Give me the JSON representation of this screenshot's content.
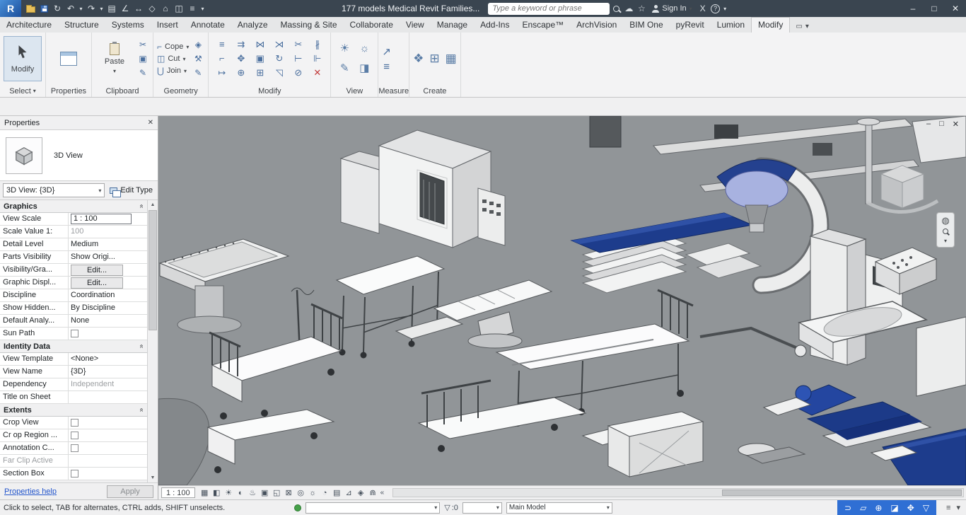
{
  "theme": {
    "titlebar_bg": "#3a4550",
    "viewport_bg": "#919598",
    "equipment_blue": "#1d3c8c",
    "status_blue": "#2f6fd4"
  },
  "titlebar": {
    "logo_text": "R",
    "qat": [
      {
        "name": "open-icon",
        "glyph": ""
      },
      {
        "name": "save-icon",
        "glyph": ""
      },
      {
        "name": "sync-icon",
        "glyph": "↻"
      },
      {
        "name": "undo-icon",
        "glyph": "↶"
      },
      {
        "name": "undo-chevron-icon",
        "glyph": "▾"
      },
      {
        "name": "redo-icon",
        "glyph": "↷"
      },
      {
        "name": "redo-chevron-icon",
        "glyph": "▾"
      },
      {
        "name": "print-icon",
        "glyph": "▤"
      },
      {
        "name": "measure-icon",
        "glyph": "∠"
      },
      {
        "name": "aligned-dimension-icon",
        "glyph": "↔"
      },
      {
        "name": "tag-icon",
        "glyph": "◇"
      },
      {
        "name": "default-3d-view-icon",
        "glyph": "⌂"
      },
      {
        "name": "section-icon",
        "glyph": "◫"
      },
      {
        "name": "thin-lines-icon",
        "glyph": "≡"
      },
      {
        "name": "qat-customize-icon",
        "glyph": "▾"
      }
    ],
    "title": "177 models Medical Revit Families...",
    "search_placeholder": "Type a keyword or phrase",
    "cloud_glyph": "☁",
    "star_glyph": "☆",
    "sign_in_label": "Sign In",
    "sign_in_chevron": "▾",
    "x_glyph": "X",
    "help_glyph": "?",
    "help_chevron": "▾",
    "window_controls": [
      {
        "name": "minimize-button",
        "glyph": "–"
      },
      {
        "name": "maximize-button",
        "glyph": "□"
      },
      {
        "name": "close-button",
        "glyph": "✕"
      }
    ]
  },
  "tabs": {
    "items": [
      {
        "label": "Architecture"
      },
      {
        "label": "Structure"
      },
      {
        "label": "Systems"
      },
      {
        "label": "Insert"
      },
      {
        "label": "Annotate"
      },
      {
        "label": "Analyze"
      },
      {
        "label": "Massing & Site"
      },
      {
        "label": "Collaborate"
      },
      {
        "label": "View"
      },
      {
        "label": "Manage"
      },
      {
        "label": "Add-Ins"
      },
      {
        "label": "Enscape™"
      },
      {
        "label": "ArchVision"
      },
      {
        "label": "BIM One"
      },
      {
        "label": "pyRevit"
      },
      {
        "label": "Lumion"
      },
      {
        "label": "Modify"
      }
    ],
    "active": "Modify",
    "display_toggle_glyph": "▭",
    "display_chevron_glyph": "▾"
  },
  "ribbon": {
    "select_panel": {
      "button_label": "Modify",
      "label": "Select",
      "chevron": "▾"
    },
    "properties_panel": {
      "label": "Properties"
    },
    "clipboard_panel": {
      "label": "Clipboard",
      "paste_label": "Paste",
      "chevron": "▾",
      "tools": [
        {
          "name": "cut-icon",
          "glyph": "✂"
        },
        {
          "name": "copy-to-clipboard-icon",
          "glyph": "▣"
        },
        {
          "name": "match-type-icon",
          "glyph": "✎"
        }
      ]
    },
    "geometry_panel": {
      "label": "Geometry",
      "chevron": "▾",
      "buttons": [
        {
          "label": "Cope",
          "glyph": "⌐"
        },
        {
          "label": "Cut",
          "glyph": "◫"
        },
        {
          "label": "Join",
          "glyph": "⋃"
        }
      ],
      "tools": [
        {
          "name": "paint-icon",
          "glyph": "◈"
        },
        {
          "name": "demolish-icon",
          "glyph": "⚒"
        },
        {
          "name": "split-face-icon",
          "glyph": "✎"
        }
      ]
    },
    "modify_panel": {
      "label": "Modify",
      "tools": [
        {
          "name": "align-icon",
          "glyph": "≡"
        },
        {
          "name": "offset-icon",
          "glyph": "⇉"
        },
        {
          "name": "mirror-axis-icon",
          "glyph": "⋈"
        },
        {
          "name": "mirror-draw-icon",
          "glyph": "⋊"
        },
        {
          "name": "split-icon",
          "glyph": "✂"
        },
        {
          "name": "split-gap-icon",
          "glyph": "∦"
        },
        {
          "name": "corner-trim-icon",
          "glyph": "⌐"
        },
        {
          "name": "move-icon",
          "glyph": "✥"
        },
        {
          "name": "copy-icon",
          "glyph": "▣"
        },
        {
          "name": "rotate-icon",
          "glyph": "↻"
        },
        {
          "name": "trim-single-icon",
          "glyph": "⊢"
        },
        {
          "name": "trim-multiple-icon",
          "glyph": "⊩"
        },
        {
          "name": "extend-icon",
          "glyph": "↦"
        },
        {
          "name": "pin-icon",
          "glyph": "⊕"
        },
        {
          "name": "array-icon",
          "glyph": "⊞"
        },
        {
          "name": "scale-icon",
          "glyph": "◹"
        },
        {
          "name": "unpin-icon",
          "glyph": "⊘"
        },
        {
          "name": "delete-icon",
          "glyph": "✕"
        }
      ]
    },
    "view_panel": {
      "label": "View",
      "tools": [
        {
          "name": "hide-elements-icon",
          "glyph": "☀"
        },
        {
          "name": "reveal-hidden-icon",
          "glyph": "☼"
        },
        {
          "name": "linework-icon",
          "glyph": "✎"
        },
        {
          "name": "cut-profile-icon",
          "glyph": "◨"
        }
      ]
    },
    "measure_panel": {
      "label": "Measure",
      "tools": [
        {
          "name": "measure-between-icon",
          "glyph": "↗"
        },
        {
          "name": "dimension-icon",
          "glyph": "≡"
        }
      ]
    },
    "create_panel": {
      "label": "Create",
      "tools": [
        {
          "name": "create-group-icon",
          "glyph": "❖"
        },
        {
          "name": "create-assembly-icon",
          "glyph": "⊞"
        },
        {
          "name": "create-parts-icon",
          "glyph": "▦"
        }
      ]
    }
  },
  "props": {
    "title": "Properties",
    "close_glyph": "✕",
    "type_label": "3D View",
    "selector_value": "3D View: {3D}",
    "selector_chevron": "▾",
    "edit_type_label": "Edit Type",
    "collapse_glyph": "«",
    "scroll_up": "▲",
    "scroll_down": "▼",
    "sections": [
      {
        "name": "Graphics",
        "rows": [
          {
            "label": "View Scale",
            "value": "1 : 100"
          },
          {
            "label": "Scale Value    1:",
            "value": "100"
          },
          {
            "label": "Detail Level",
            "value": "Medium"
          },
          {
            "label": "Parts Visibility",
            "value": "Show Origi..."
          },
          {
            "label": "Visibility/Gra...",
            "value": "Edit..."
          },
          {
            "label": "Graphic Displ...",
            "value": "Edit..."
          },
          {
            "label": "Discipline",
            "value": "Coordination"
          },
          {
            "label": "Show Hidden...",
            "value": "By Discipline"
          },
          {
            "label": "Default Analy...",
            "value": "None"
          },
          {
            "label": "Sun Path",
            "value": ""
          }
        ]
      },
      {
        "name": "Identity Data",
        "rows": [
          {
            "label": "View Template",
            "value": "<None>"
          },
          {
            "label": "View Name",
            "value": "{3D}"
          },
          {
            "label": "Dependency",
            "value": "Independent"
          },
          {
            "label": "Title on Sheet",
            "value": ""
          }
        ]
      },
      {
        "name": "Extents",
        "rows": [
          {
            "label": "Crop View",
            "value": ""
          },
          {
            "label": "Cr op Region ...",
            "value": ""
          },
          {
            "label": "Annotation C...",
            "value": ""
          },
          {
            "label": "Far Clip Active",
            "value": ""
          },
          {
            "label": "Section Box",
            "value": ""
          }
        ]
      }
    ],
    "help_label": "Properties help",
    "apply_label": "Apply"
  },
  "viewport": {
    "window_controls": [
      {
        "name": "view-minimize-button",
        "glyph": "–"
      },
      {
        "name": "view-restore-button",
        "glyph": "□"
      },
      {
        "name": "view-close-button",
        "glyph": "✕"
      }
    ],
    "navbar": {
      "wheel_glyph": "◍",
      "chevron": "▾"
    }
  },
  "viewbar": {
    "scale_label": "1 : 100",
    "icons": [
      {
        "name": "detail-level-icon",
        "glyph": "▦"
      },
      {
        "name": "visual-style-icon",
        "glyph": "◧"
      },
      {
        "name": "sun-path-icon",
        "glyph": "☀"
      },
      {
        "name": "shadows-icon",
        "glyph": "◐"
      },
      {
        "name": "rendering-dialog-icon",
        "glyph": "♨"
      },
      {
        "name": "crop-view-icon",
        "glyph": "▣"
      },
      {
        "name": "crop-region-icon",
        "glyph": "◱"
      },
      {
        "name": "lock-view-icon",
        "glyph": "⊠"
      },
      {
        "name": "temporary-hide-icon",
        "glyph": "◎"
      },
      {
        "name": "reveal-hidden-icon",
        "glyph": "☼"
      },
      {
        "name": "worksharing-display-icon",
        "glyph": "◔"
      },
      {
        "name": "temporary-view-properties-icon",
        "glyph": "▤"
      },
      {
        "name": "analytical-model-icon",
        "glyph": "⊿"
      },
      {
        "name": "displacement-sets-icon",
        "glyph": "◈"
      },
      {
        "name": "reveal-constraints-icon",
        "glyph": "⋒"
      }
    ],
    "collapse_glyph": "«"
  },
  "statusbar": {
    "hint": "Click to select, TAB for alternates, CTRL adds, SHIFT unselects.",
    "workset_value": "",
    "filter_glyph": "▽",
    "filter_count": ":0",
    "small_combo_value": "",
    "design_option_value": "Main Model",
    "chevron": "▾",
    "selection_icons": [
      {
        "name": "select-links-icon",
        "glyph": "⊃"
      },
      {
        "name": "select-underlay-icon",
        "glyph": "▱"
      },
      {
        "name": "select-pinned-icon",
        "glyph": "⊕"
      },
      {
        "name": "select-by-face-icon",
        "glyph": "◪"
      },
      {
        "name": "drag-on-selection-icon",
        "glyph": "✥"
      },
      {
        "name": "selection-filter-icon",
        "glyph": "▽"
      }
    ],
    "tray_icons": [
      {
        "name": "background-processes-icon",
        "glyph": "≡"
      },
      {
        "name": "status-chevron-icon",
        "glyph": "▾"
      }
    ]
  }
}
